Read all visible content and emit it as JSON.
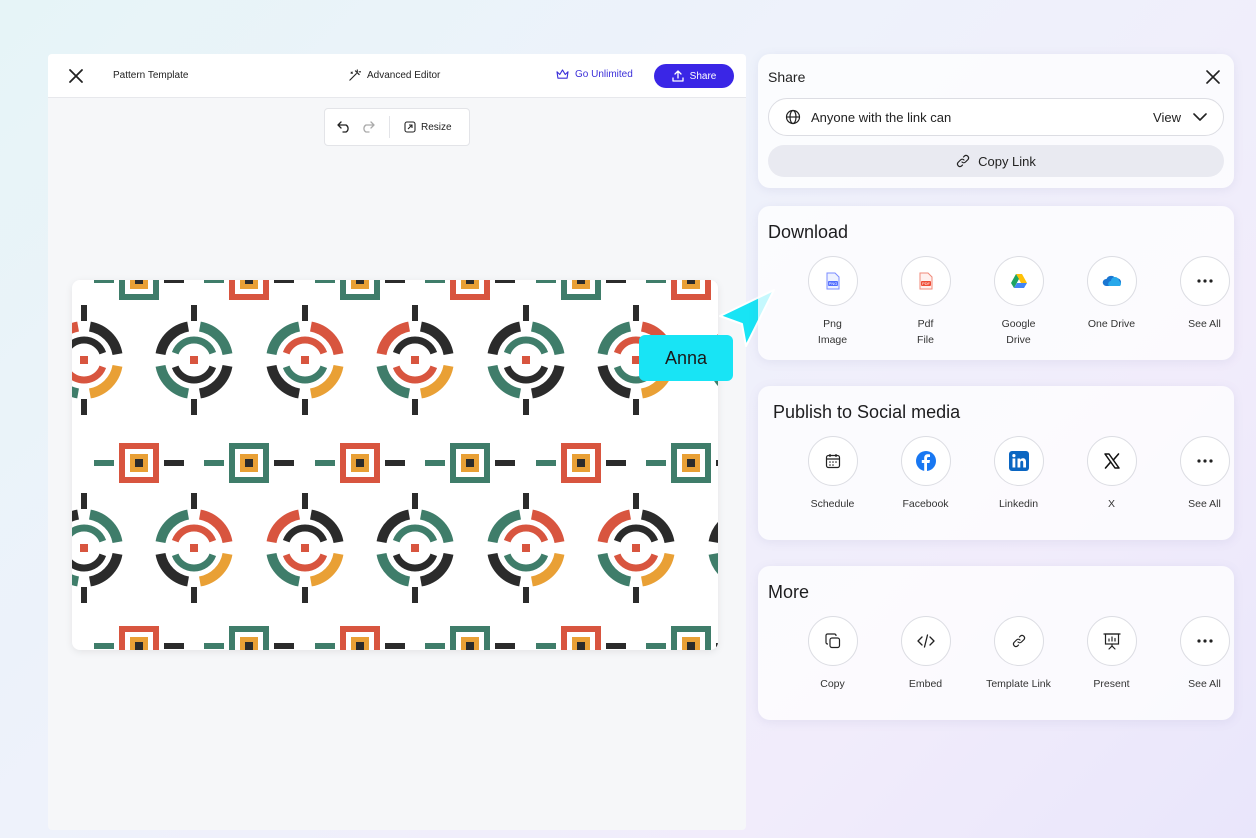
{
  "editor": {
    "title": "Pattern Template",
    "advanced_editor": "Advanced Editor",
    "go_unlimited": "Go Unlimited",
    "share_label": "Share",
    "resize_label": "Resize"
  },
  "collaborator": {
    "name": "Anna",
    "color": "#18e4f5"
  },
  "share_panel": {
    "title": "Share",
    "access_text": "Anyone with the link can",
    "access_value": "View",
    "copy_link": "Copy Link"
  },
  "download": {
    "title": "Download",
    "items": [
      {
        "label": "Png\nImage",
        "icon": "png-icon"
      },
      {
        "label": "Pdf\nFile",
        "icon": "pdf-icon"
      },
      {
        "label": "Google\nDrive",
        "icon": "google-drive-icon"
      },
      {
        "label": "One Drive",
        "icon": "onedrive-icon"
      },
      {
        "label": "See All",
        "icon": "more-icon"
      }
    ]
  },
  "social": {
    "title": "Publish to Social media",
    "items": [
      {
        "label": "Schedule",
        "icon": "calendar-icon"
      },
      {
        "label": "Facebook",
        "icon": "facebook-icon"
      },
      {
        "label": "Linkedin",
        "icon": "linkedin-icon"
      },
      {
        "label": "X",
        "icon": "x-icon"
      },
      {
        "label": "See All",
        "icon": "more-icon"
      }
    ]
  },
  "more": {
    "title": "More",
    "items": [
      {
        "label": "Copy",
        "icon": "copy-icon"
      },
      {
        "label": "Embed",
        "icon": "embed-icon"
      },
      {
        "label": "Template Link",
        "icon": "link-icon"
      },
      {
        "label": "Present",
        "icon": "present-icon"
      },
      {
        "label": "See All",
        "icon": "more-icon"
      }
    ]
  },
  "colors": {
    "primary": "#3a26e6",
    "pattern_red": "#d8553f",
    "pattern_orange": "#e9a035",
    "pattern_green": "#3f7d6a",
    "pattern_dark": "#2b2b2b"
  }
}
